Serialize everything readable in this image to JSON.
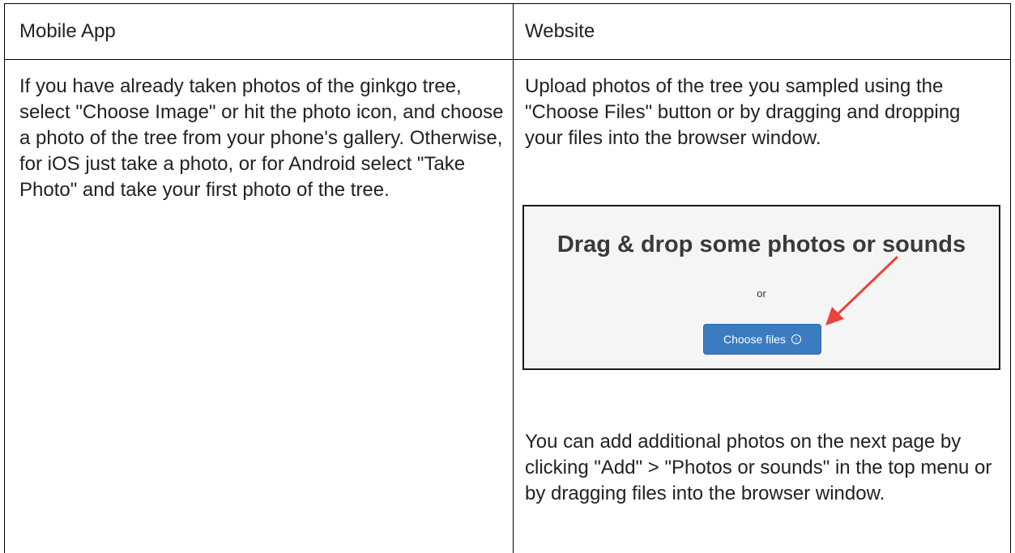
{
  "table": {
    "headers": {
      "left": "Mobile App",
      "right": "Website"
    },
    "left_body": "If you have already taken photos of the ginkgo tree, select \"Choose Image\" or hit the photo icon, and choose a photo of the tree from your phone's gallery.  Otherwise, for iOS just take a photo, or for Android select \"Take Photo\" and take your first photo of the tree.",
    "right_top": "Upload photos of the tree you sampled using the \"Choose Files\" button or by dragging and dropping your files into the browser window.",
    "right_bottom": "You can add additional photos on the next page by clicking \"Add\" > \"Photos or sounds\" in the top menu or by dragging files into the browser window."
  },
  "upload_screenshot": {
    "title": "Drag & drop some photos or sounds",
    "or_text": "or",
    "button_label": "Choose files",
    "button_icon": "upload-circle-arrow-icon",
    "annotation": "red-arrow-pointing-to-button",
    "colors": {
      "button_bg": "#3a7cbf",
      "arrow": "#e8443a",
      "panel_bg": "#f5f5f5"
    }
  }
}
